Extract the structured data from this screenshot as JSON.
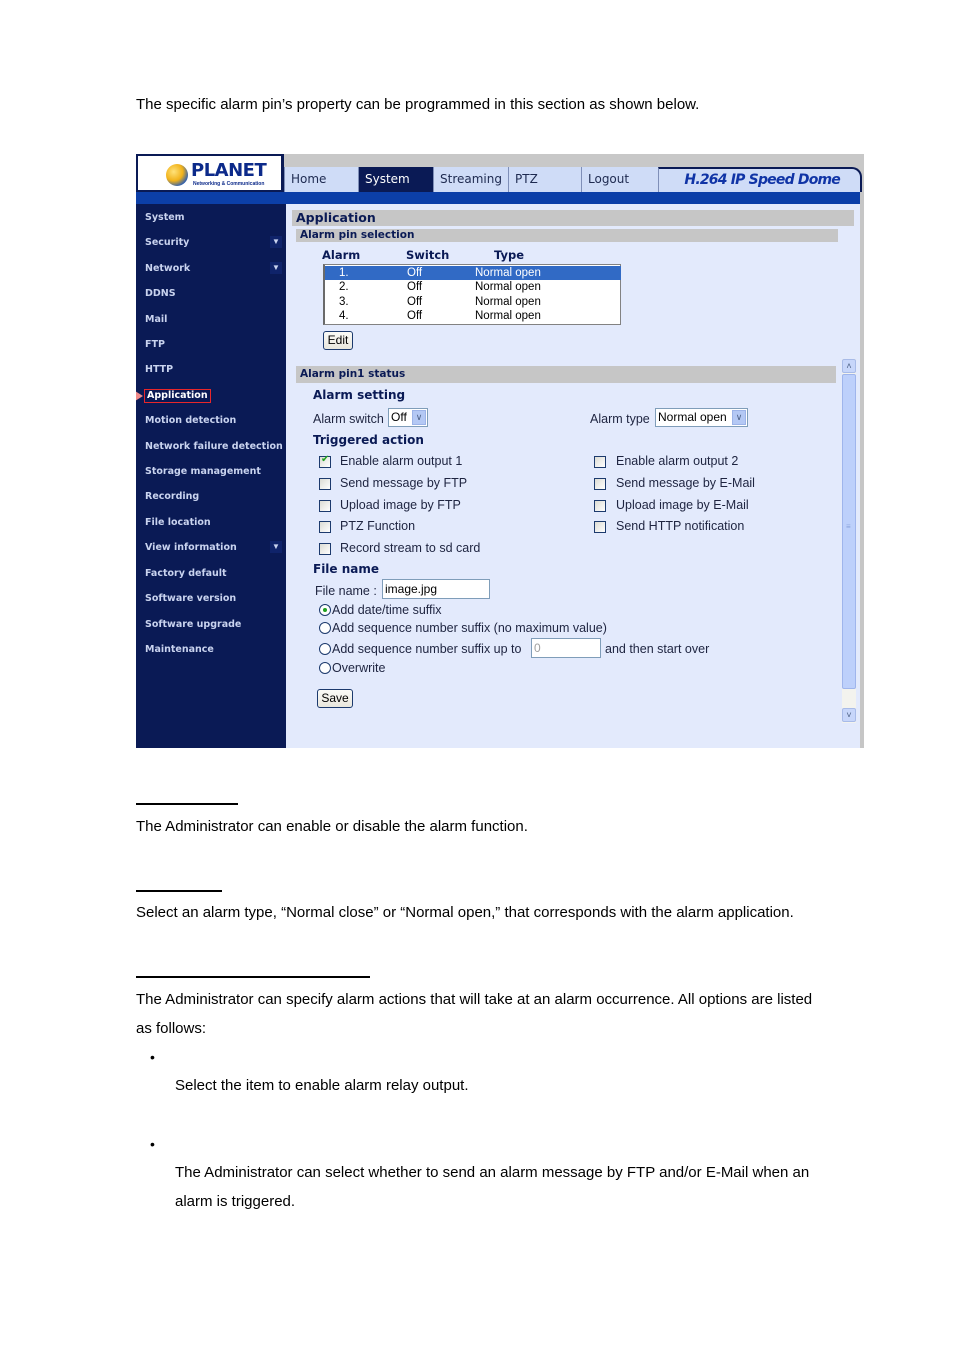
{
  "document": {
    "intro": "The specific alarm pin’s property can be programmed in this section as shown below.",
    "para_alarm_switch": "The Administrator can enable or disable the alarm function.",
    "para_alarm_type": "Select an alarm type, “Normal close” or “Normal open,” that corresponds with the alarm application.",
    "para_triggered_line1": "The Administrator can specify alarm actions that will take at an alarm occurrence. All options are listed",
    "para_triggered_line2": "as follows:",
    "bullet1_text": "Select the item to enable alarm relay output.",
    "bullet2_line1": "The Administrator can select whether to send an alarm message by FTP and/or E-Mail when an",
    "bullet2_line2": "alarm is triggered.",
    "bullet_glyph": "•"
  },
  "header": {
    "logo_word": "PLANET",
    "logo_tagline": "Networking & Communication",
    "tabs": [
      {
        "label": "Home",
        "active": false
      },
      {
        "label": "System",
        "active": true
      },
      {
        "label": "Streaming",
        "active": false
      },
      {
        "label": "PTZ",
        "active": false
      },
      {
        "label": "Logout",
        "active": false
      }
    ],
    "product_name": "H.264 IP Speed Dome"
  },
  "sidebar": {
    "items": [
      {
        "label": "System"
      },
      {
        "label": "Security",
        "expandable": true
      },
      {
        "label": "Network",
        "expandable": true
      },
      {
        "label": "DDNS"
      },
      {
        "label": "Mail"
      },
      {
        "label": "FTP"
      },
      {
        "label": "HTTP"
      },
      {
        "label": "Application",
        "current": true
      },
      {
        "label": "Motion detection"
      },
      {
        "label": "Network failure detection"
      },
      {
        "label": "Storage management"
      },
      {
        "label": "Recording"
      },
      {
        "label": "File location"
      },
      {
        "label": "View information",
        "expandable": true
      },
      {
        "label": "Factory default"
      },
      {
        "label": "Software version"
      },
      {
        "label": "Software upgrade"
      },
      {
        "label": "Maintenance"
      }
    ],
    "caret_glyph": "▼",
    "pointer_icon": "triangle-right"
  },
  "main": {
    "page_title": "Application",
    "pin_selection": {
      "title": "Alarm pin selection",
      "columns": [
        "Alarm",
        "Switch",
        "Type"
      ],
      "rows": [
        {
          "alarm": "1.",
          "switch": "Off",
          "type": "Normal open",
          "selected": true
        },
        {
          "alarm": "2.",
          "switch": "Off",
          "type": "Normal open",
          "selected": false
        },
        {
          "alarm": "3.",
          "switch": "Off",
          "type": "Normal open",
          "selected": false
        },
        {
          "alarm": "4.",
          "switch": "Off",
          "type": "Normal open",
          "selected": false
        }
      ],
      "edit_label": "Edit"
    },
    "pin_status": {
      "title": "Alarm pin1 status",
      "alarm_setting_heading": "Alarm setting",
      "alarm_switch_label": "Alarm switch",
      "alarm_switch_value": "Off",
      "alarm_type_label": "Alarm type",
      "alarm_type_value": "Normal open",
      "dropdown_glyph": "∨",
      "triggered_heading": "Triggered action",
      "actions": [
        {
          "label": "Enable alarm output 1",
          "checked": true
        },
        {
          "label": "Send message by FTP",
          "checked": false
        },
        {
          "label": "Upload image by FTP",
          "checked": false
        },
        {
          "label": "PTZ Function",
          "checked": false
        },
        {
          "label": "Record stream to sd card",
          "checked": false
        },
        {
          "label": "Enable alarm output 2",
          "checked": false
        },
        {
          "label": "Send message by E-Mail",
          "checked": false
        },
        {
          "label": "Upload image by E-Mail",
          "checked": false
        },
        {
          "label": "Send HTTP notification",
          "checked": false
        }
      ],
      "file_name_heading": "File name",
      "file_name_label": "File name :",
      "file_name_value": "image.jpg",
      "suffix_options": [
        {
          "label": "Add date/time suffix",
          "selected": true
        },
        {
          "label": "Add sequence number suffix (no maximum value)",
          "selected": false
        },
        {
          "label": "Add sequence number suffix up to",
          "selected": false
        },
        {
          "label": "Overwrite",
          "selected": false
        }
      ],
      "sequence_max_value": "0",
      "sequence_tail": "and then start over",
      "save_label": "Save"
    },
    "scrollbar": {
      "up_glyph": "˄",
      "down_glyph": "˅",
      "grip_glyph": "≡"
    }
  }
}
